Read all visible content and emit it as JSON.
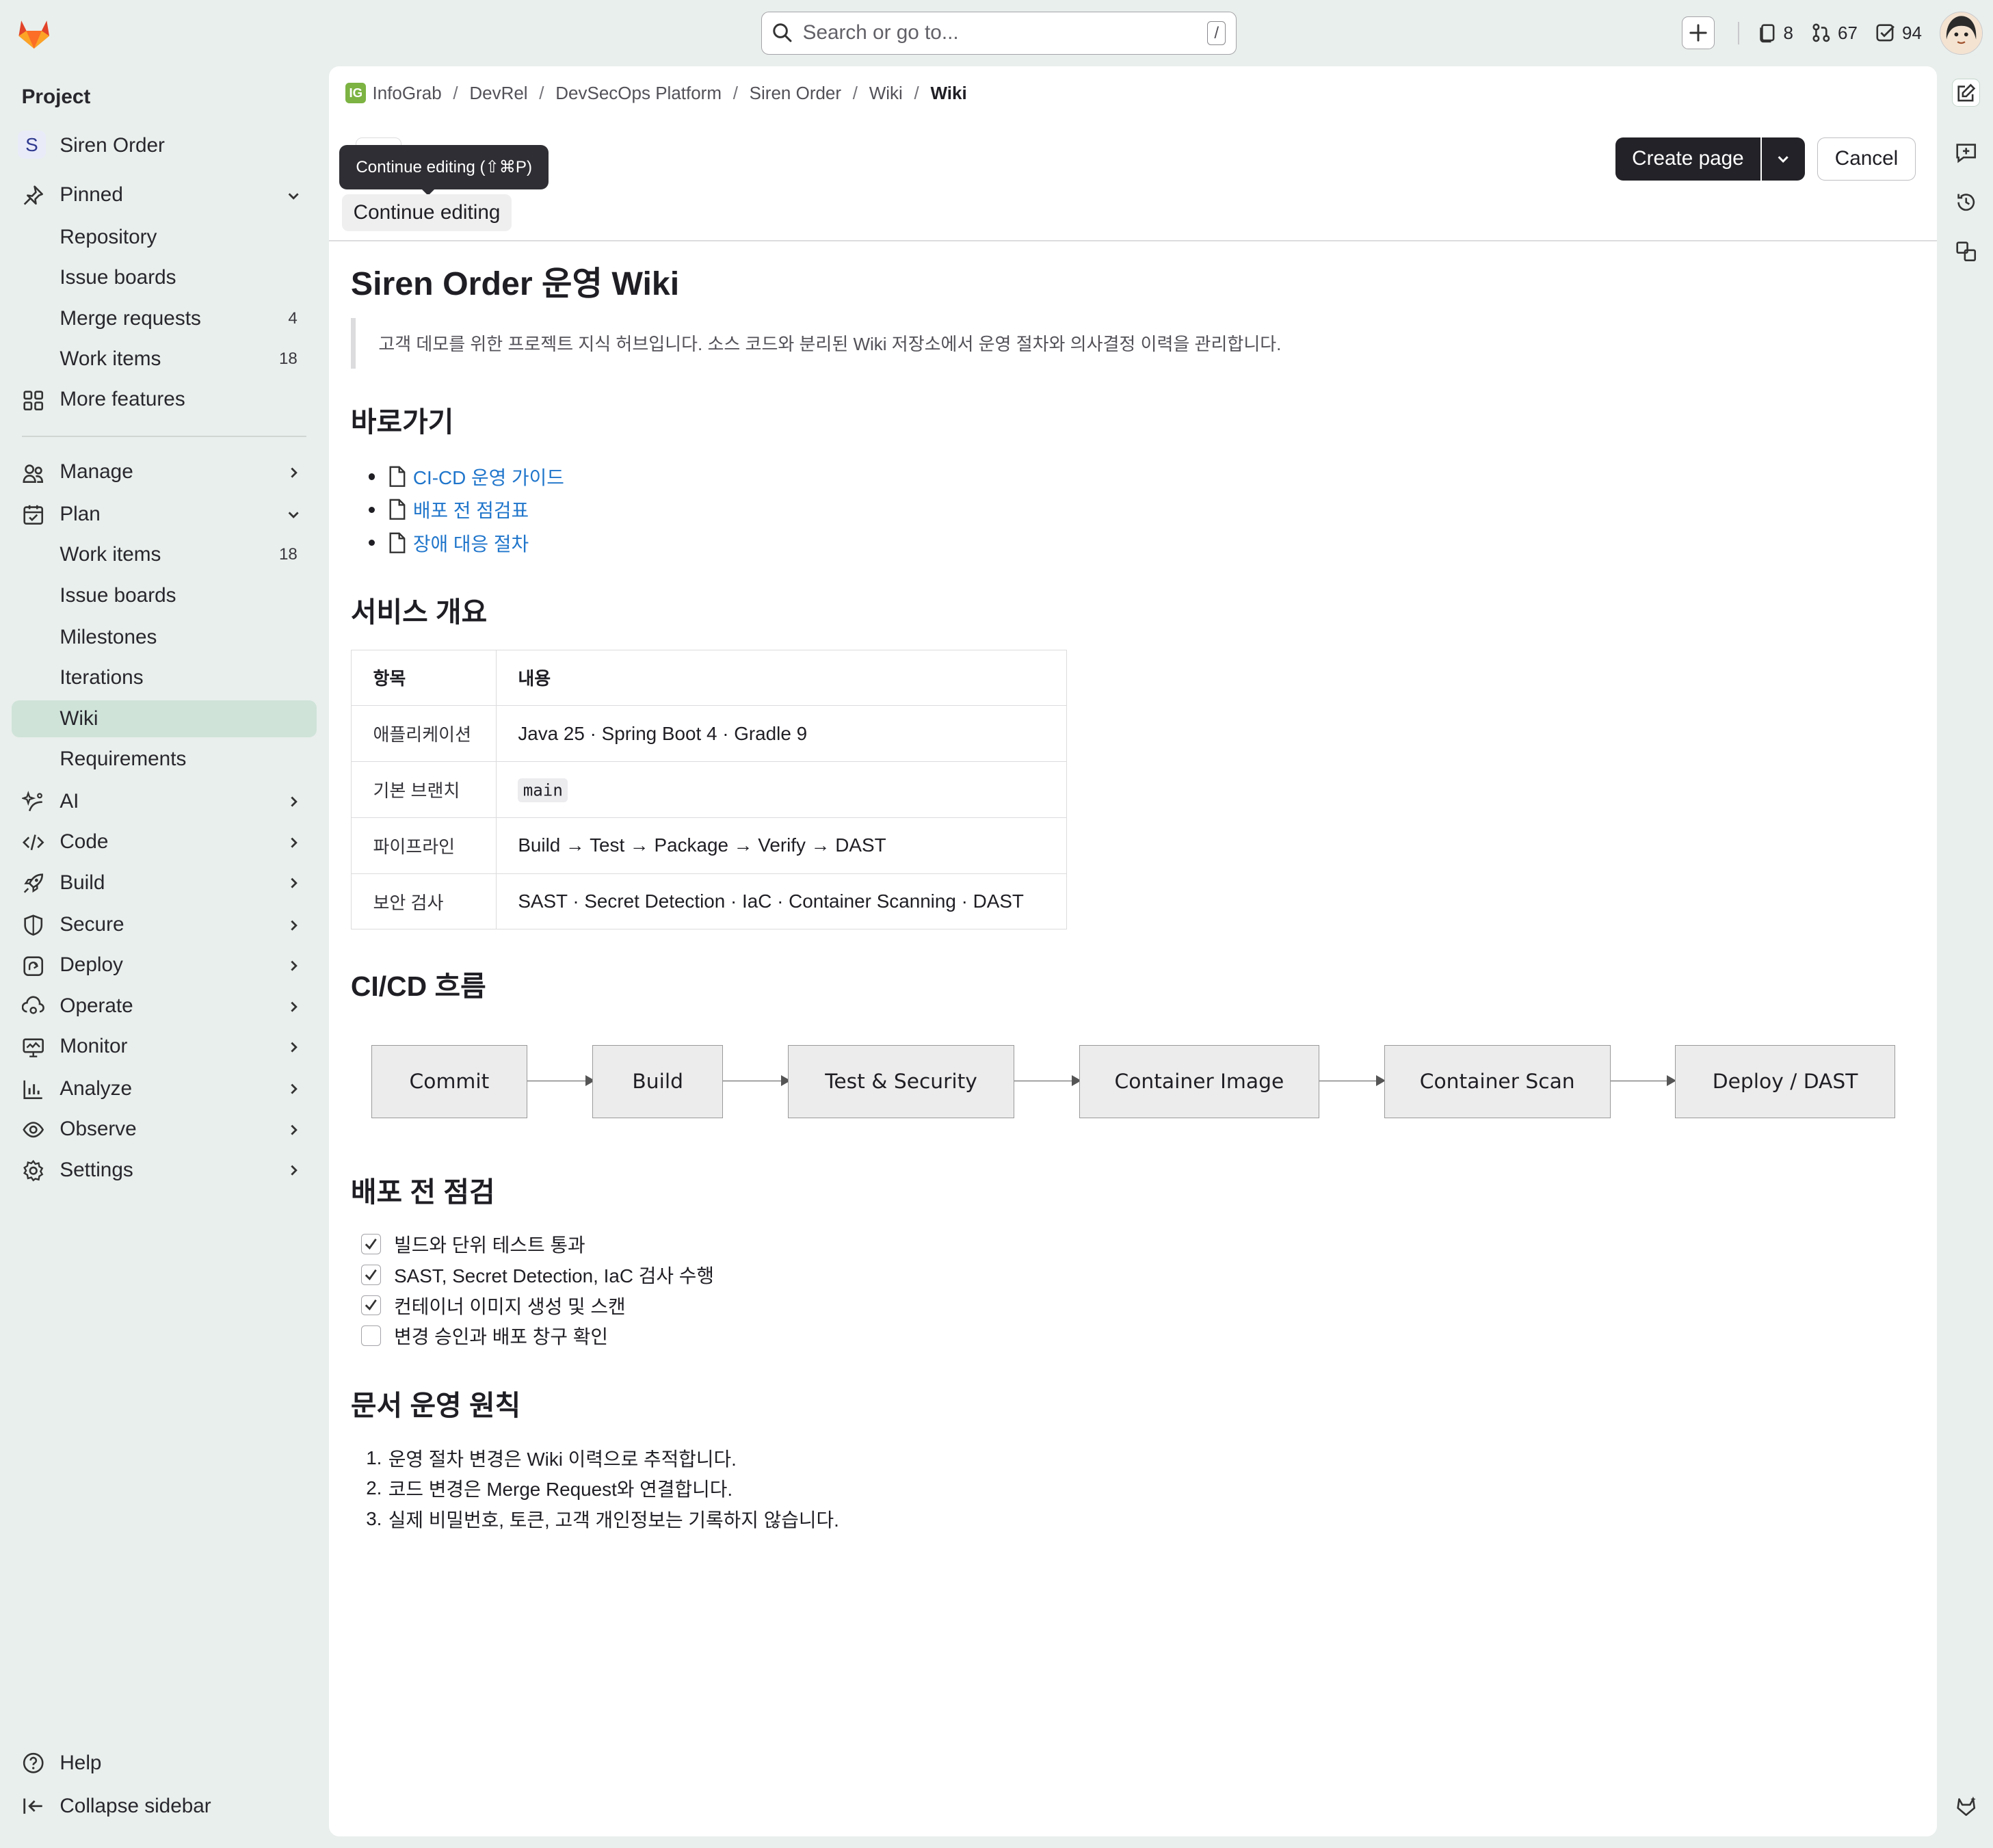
{
  "topbar": {
    "search_placeholder": "Search or go to...",
    "search_shortcut": "/",
    "counters": [
      {
        "icon": "issues-icon",
        "value": "8"
      },
      {
        "icon": "merge-request-icon",
        "value": "67"
      },
      {
        "icon": "todo-icon",
        "value": "94"
      }
    ]
  },
  "sidebar": {
    "section_title": "Project",
    "project_initial": "S",
    "project_name": "Siren Order",
    "pinned_label": "Pinned",
    "pinned_items": [
      {
        "label": "Repository",
        "count": ""
      },
      {
        "label": "Issue boards",
        "count": ""
      },
      {
        "label": "Merge requests",
        "count": "4"
      },
      {
        "label": "Work items",
        "count": "18"
      }
    ],
    "more_features": "More features",
    "manage": "Manage",
    "plan": "Plan",
    "plan_items": [
      {
        "label": "Work items",
        "count": "18"
      },
      {
        "label": "Issue boards",
        "count": ""
      },
      {
        "label": "Milestones",
        "count": ""
      },
      {
        "label": "Iterations",
        "count": ""
      },
      {
        "label": "Wiki",
        "count": ""
      },
      {
        "label": "Requirements",
        "count": ""
      }
    ],
    "groups": [
      "AI",
      "Code",
      "Build",
      "Secure",
      "Deploy",
      "Operate",
      "Monitor",
      "Analyze",
      "Observe",
      "Settings"
    ],
    "help": "Help",
    "collapse": "Collapse sidebar"
  },
  "breadcrumbs": {
    "logo_text": "IG",
    "items": [
      "InfoGrab",
      "DevRel",
      "DevSecOps Platform",
      "Siren Order",
      "Wiki",
      "Wiki"
    ]
  },
  "toolbar": {
    "tooltip": "Continue editing (⇧⌘P)",
    "continue_label": "Continue editing",
    "create_label": "Create page",
    "cancel_label": "Cancel"
  },
  "wiki": {
    "title": "Siren Order 운영 Wiki",
    "intro": "고객 데모를 위한 프로젝트 지식 허브입니다. 소스 코드와 분리된 Wiki 저장소에서 운영 절차와 의사결정 이력을 관리합니다.",
    "shortcuts_heading": "바로가기",
    "shortcuts": [
      "CI-CD 운영 가이드",
      "배포 전 점검표",
      "장애 대응 절차"
    ],
    "overview_heading": "서비스 개요",
    "overview_headers": [
      "항목",
      "내용"
    ],
    "overview_rows": [
      {
        "key": "애플리케이션",
        "value": "Java 25 · Spring Boot 4 · Gradle 9"
      },
      {
        "key": "기본 브랜치",
        "value": "main"
      },
      {
        "key": "파이프라인",
        "value": "Build → Test → Package → Verify → DAST"
      },
      {
        "key": "보안 검사",
        "value": "SAST · Secret Detection · IaC · Container Scanning · DAST"
      }
    ],
    "flow_heading": "CI/CD 흐름",
    "flow_nodes": [
      "Commit",
      "Build",
      "Test & Security",
      "Container Image",
      "Container Scan",
      "Deploy / DAST"
    ],
    "checklist_heading": "배포 전 점검",
    "checklist": [
      {
        "label": "빌드와 단위 테스트 통과",
        "checked": true
      },
      {
        "label": "SAST, Secret Detection, IaC 검사 수행",
        "checked": true
      },
      {
        "label": "컨테이너 이미지 생성 및 스캔",
        "checked": true
      },
      {
        "label": "변경 승인과 배포 창구 확인",
        "checked": false
      }
    ],
    "principles_heading": "문서 운영 원칙",
    "principles": [
      "운영 절차 변경은 Wiki 이력으로 추적합니다.",
      "코드 변경은 Merge Request와 연결합니다.",
      "실제 비밀번호, 토큰, 고객 개인정보는 기록하지 않습니다."
    ]
  }
}
